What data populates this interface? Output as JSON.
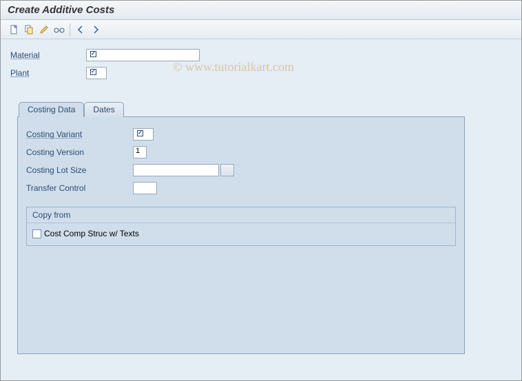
{
  "header": {
    "title": "Create Additive Costs"
  },
  "toolbar": {
    "new_icon": "new-document",
    "copy_icon": "copy",
    "edit_icon": "pencil",
    "display_icon": "glasses",
    "prev_icon": "previous",
    "next_icon": "next"
  },
  "watermark": "© www.tutorialkart.com",
  "fields": {
    "material_label": "Material",
    "material_value": "",
    "plant_label": "Plant",
    "plant_value": ""
  },
  "tabs": {
    "costing_data": "Costing Data",
    "dates": "Dates"
  },
  "costing": {
    "variant_label": "Costing Variant",
    "variant_value": "",
    "version_label": "Costing Version",
    "version_value": "1",
    "lot_size_label": "Costing Lot Size",
    "lot_size_value": "",
    "transfer_label": "Transfer Control",
    "transfer_value": ""
  },
  "group": {
    "title": "Copy from",
    "chk_label": "Cost Comp Struc w/ Texts",
    "chk_value": false
  }
}
